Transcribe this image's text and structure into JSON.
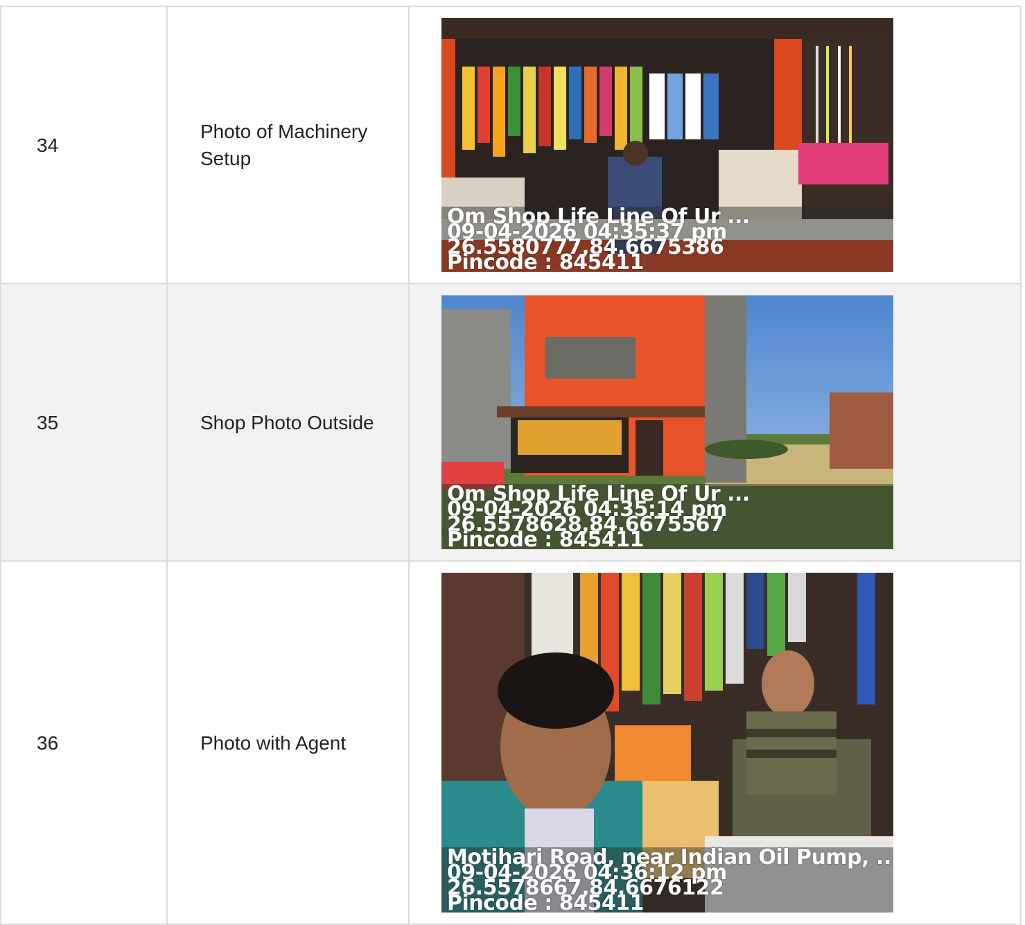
{
  "rows": [
    {
      "number": "34",
      "label": "Photo of Machinery Setup",
      "photo": {
        "scene": "shop-interior",
        "stamp": {
          "title": "Om Shop Life Line Of Ur ...",
          "datetime": "09-04-2026 04:35:37 pm",
          "coords": "26.5580777,84.6675386",
          "pincode": "Pincode : 845411"
        }
      }
    },
    {
      "number": "35",
      "label": "Shop Photo Outside",
      "photo": {
        "scene": "shop-exterior",
        "stamp": {
          "title": "Om Shop Life Line Of Ur ...",
          "datetime": "09-04-2026 04:35:14 pm",
          "coords": "26.5578628,84.6675567",
          "pincode": "Pincode : 845411"
        }
      }
    },
    {
      "number": "36",
      "label": "Photo with Agent",
      "photo": {
        "scene": "selfie-with-agent",
        "stamp": {
          "title": "Motihari Road, near Indian Oil Pump, ...",
          "datetime": "09-04-2026 04:36:12 pm",
          "coords": "26.5578667,84.6676122",
          "pincode": "Pincode : 845411"
        }
      }
    }
  ],
  "colors": {
    "border": "#dcdcdc",
    "alt_row": "#f2f2f2",
    "shop_orange": "#e8532a"
  }
}
